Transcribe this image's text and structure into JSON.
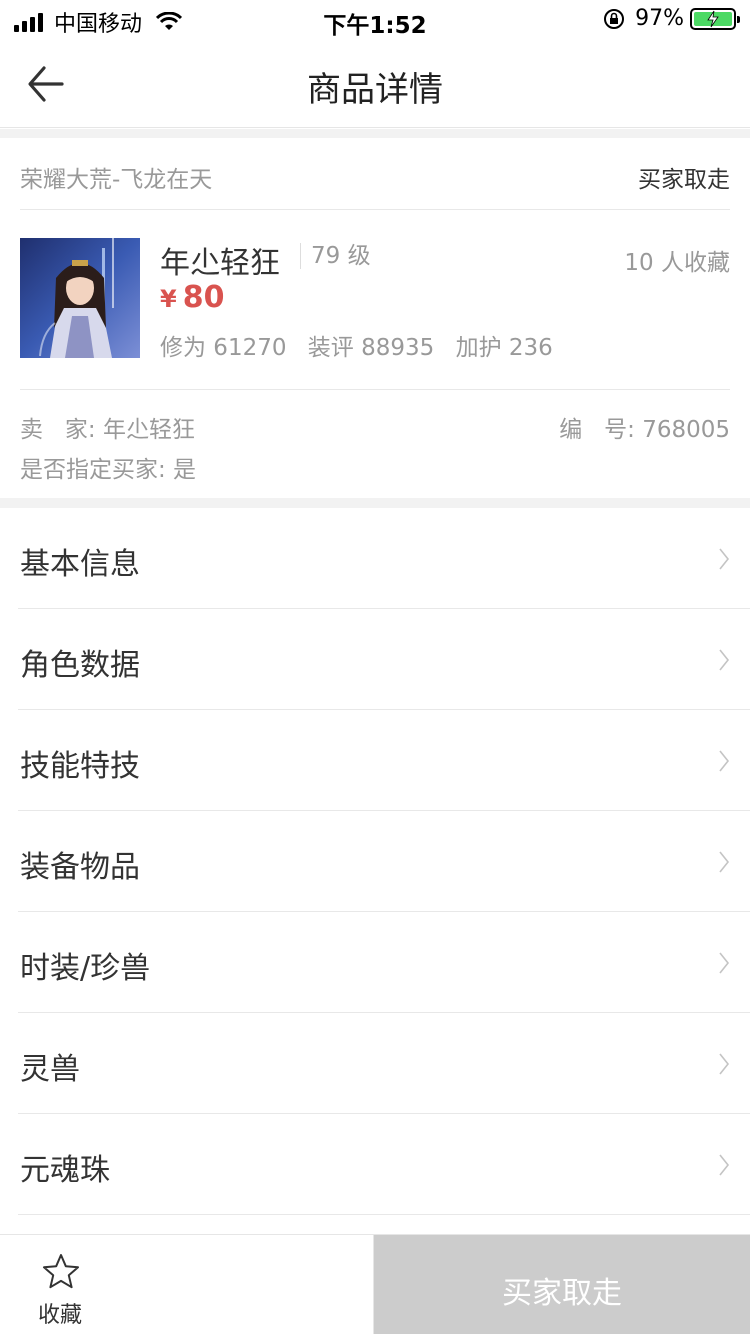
{
  "status_bar": {
    "carrier": "中国移动",
    "time": "下午1:52",
    "battery_percent": "97%",
    "icons": [
      "signal-icon",
      "wifi-icon",
      "rotation-lock-icon",
      "battery-charging-icon"
    ]
  },
  "nav": {
    "title": "商品详情",
    "back_icon": "back-arrow-icon"
  },
  "product": {
    "server": "荣耀大荒-飞龙在天",
    "status": "买家取走",
    "name": "年尐轻狂",
    "level": "79 级",
    "favorites": "10 人收藏",
    "currency_symbol": "¥",
    "price": "80",
    "stats": {
      "cultivation": "修为 61270",
      "gear_score": "装评 88935",
      "protection": "加护 236"
    },
    "seller": "卖   家: 年尐轻狂",
    "serial": "编   号: 768005",
    "designated_buyer": "是否指定买家: 是"
  },
  "menu": {
    "items": [
      {
        "label": "基本信息"
      },
      {
        "label": "角色数据"
      },
      {
        "label": "技能特技"
      },
      {
        "label": "装备物品"
      },
      {
        "label": "时装/珍兽"
      },
      {
        "label": "灵兽"
      },
      {
        "label": "元魂珠"
      }
    ]
  },
  "bottom_bar": {
    "favorite_label": "收藏",
    "buy_label": "买家取走"
  },
  "colors": {
    "price_red": "#d9534f",
    "disabled_button": "#cccccc",
    "battery_green": "#4cd964",
    "muted_text": "#999999"
  }
}
